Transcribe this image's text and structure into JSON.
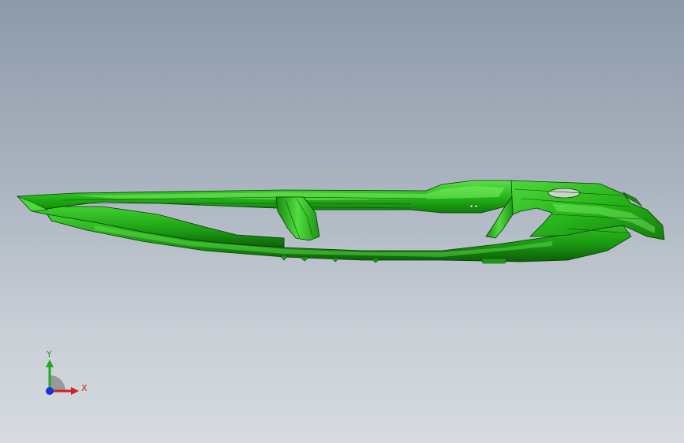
{
  "viewport": {
    "background_top": "#8e9aaa",
    "background_bottom": "#d6dbe0"
  },
  "model": {
    "part_color": "#2ec21e",
    "part_shadow_color": "#0f6e0a",
    "edge_color": "#0a3a06"
  },
  "triad": {
    "x_label": "X",
    "y_label": "Y",
    "x_color": "#d42020",
    "y_color": "#22a822",
    "z_color": "#1a33d6"
  }
}
